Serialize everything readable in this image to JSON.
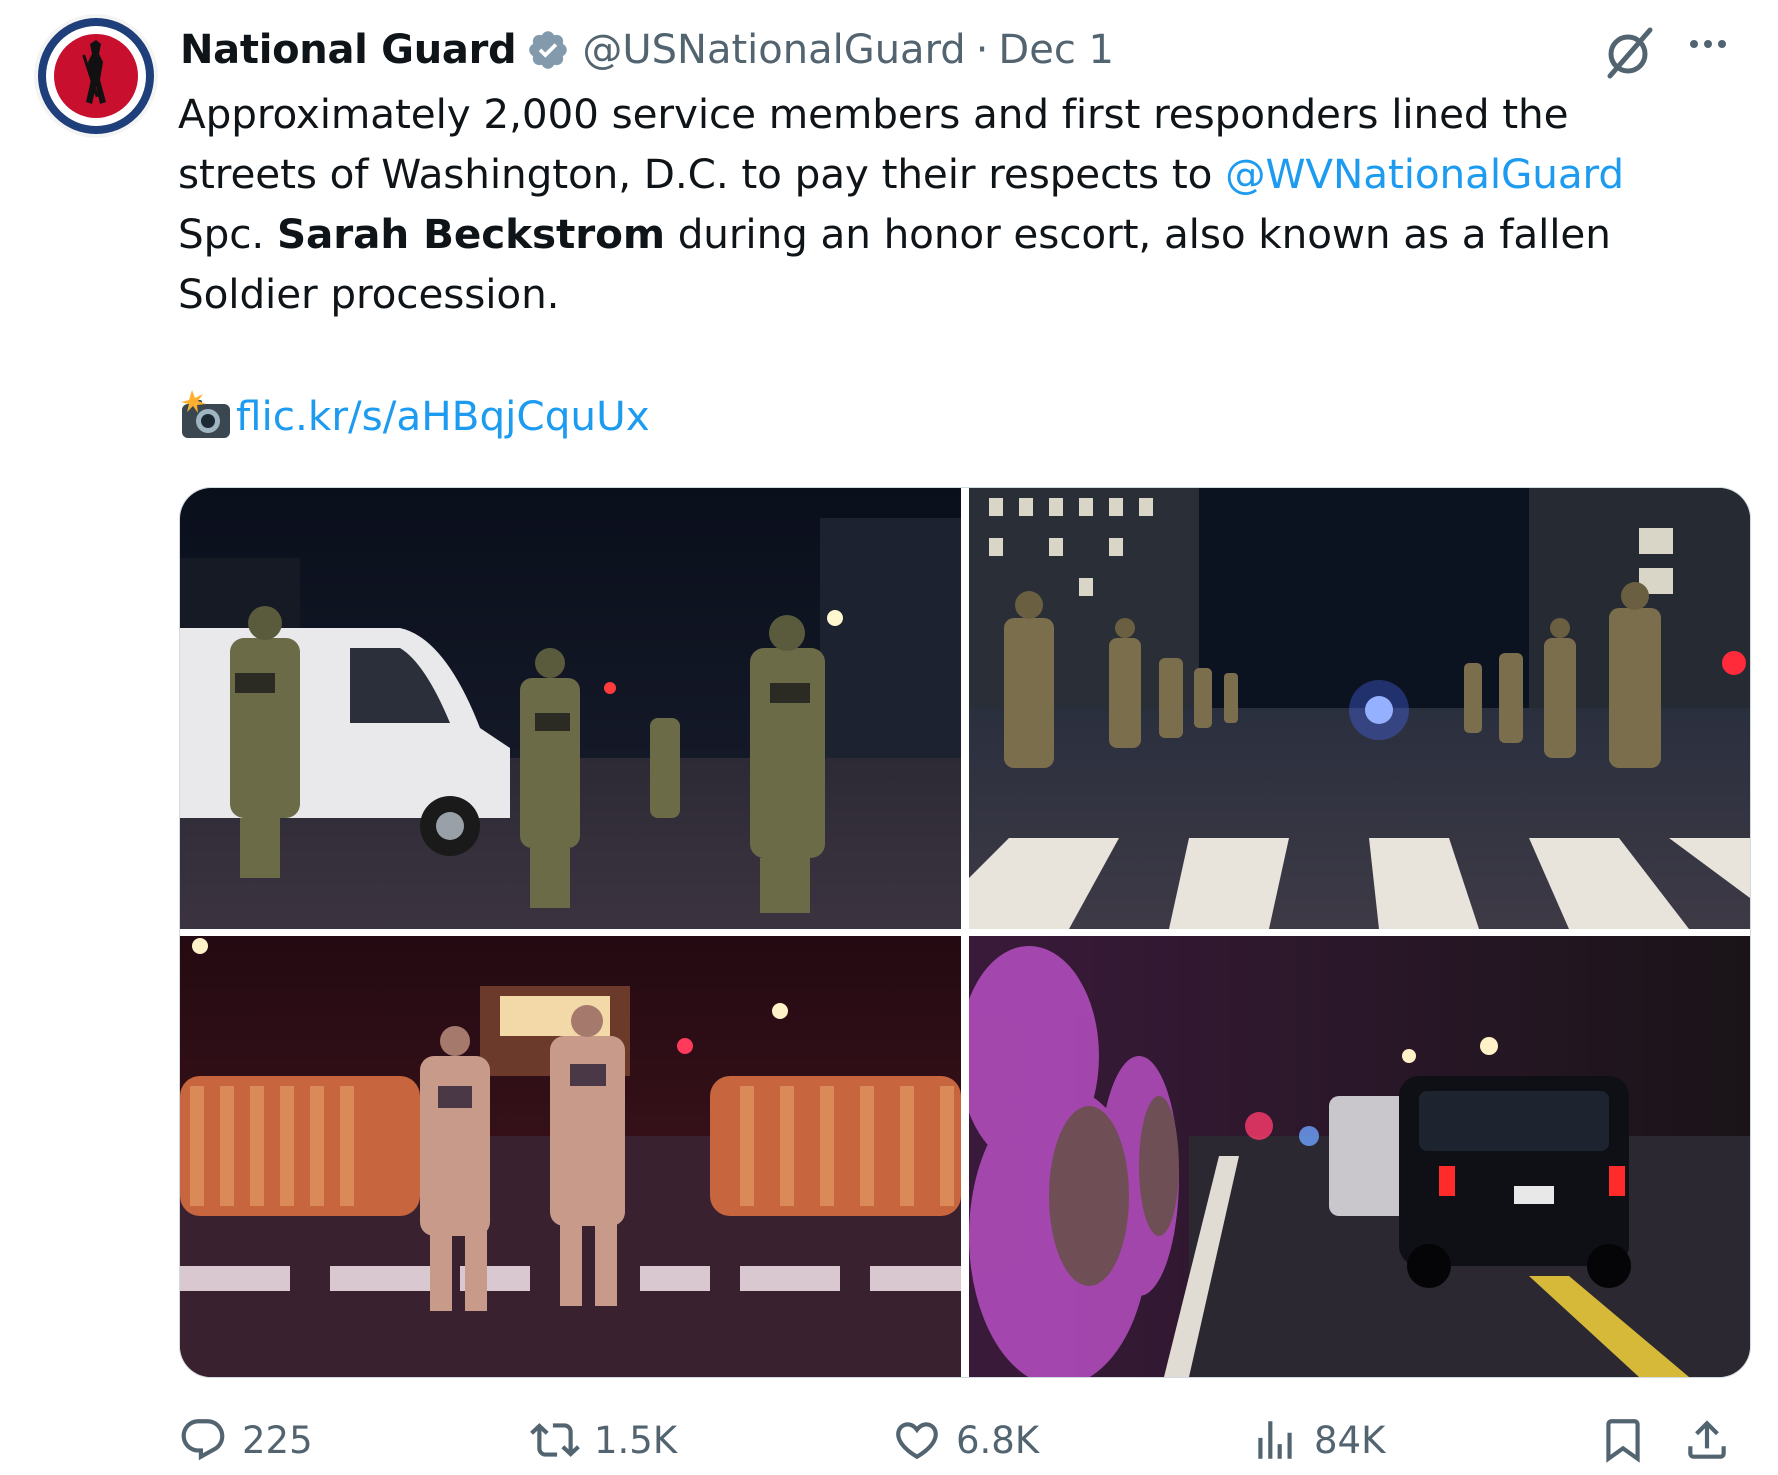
{
  "author": {
    "display_name": "National Guard",
    "handle": "@USNationalGuard",
    "separator": "·",
    "date": "Dec 1",
    "avatar_icon": "national-guard-seal-icon",
    "verified_icon": "verified-badge-icon"
  },
  "header_icons": {
    "grok": "grok-icon",
    "more": "more-icon"
  },
  "text": {
    "part1": "Approximately 2,000 service members and first responders lined the streets of Washington, D.C. to pay their respects to ",
    "mention": "@WVNationalGuard",
    "part2": " Spc. ",
    "bold_name": "Sarah Beckstrom",
    "part3": " during an honor escort, also known as a fallen Soldier procession.",
    "link_emoji": "camera-with-flash-icon",
    "link": "flic.kr/s/aHBqjCquUx"
  },
  "media": {
    "photos": [
      {
        "name": "photo-guard-members-saluting-van"
      },
      {
        "name": "photo-soldiers-lining-street-crosswalk"
      },
      {
        "name": "photo-two-soldiers-walking-procession"
      },
      {
        "name": "photo-motorcade-passing-soldiers"
      }
    ]
  },
  "actions": {
    "reply_count": "225",
    "retweet_count": "1.5K",
    "like_count": "6.8K",
    "views_count": "84K"
  },
  "colors": {
    "text": "#0f1419",
    "secondary": "#536471",
    "link": "#1d9bf0",
    "verified": "#829aab"
  }
}
